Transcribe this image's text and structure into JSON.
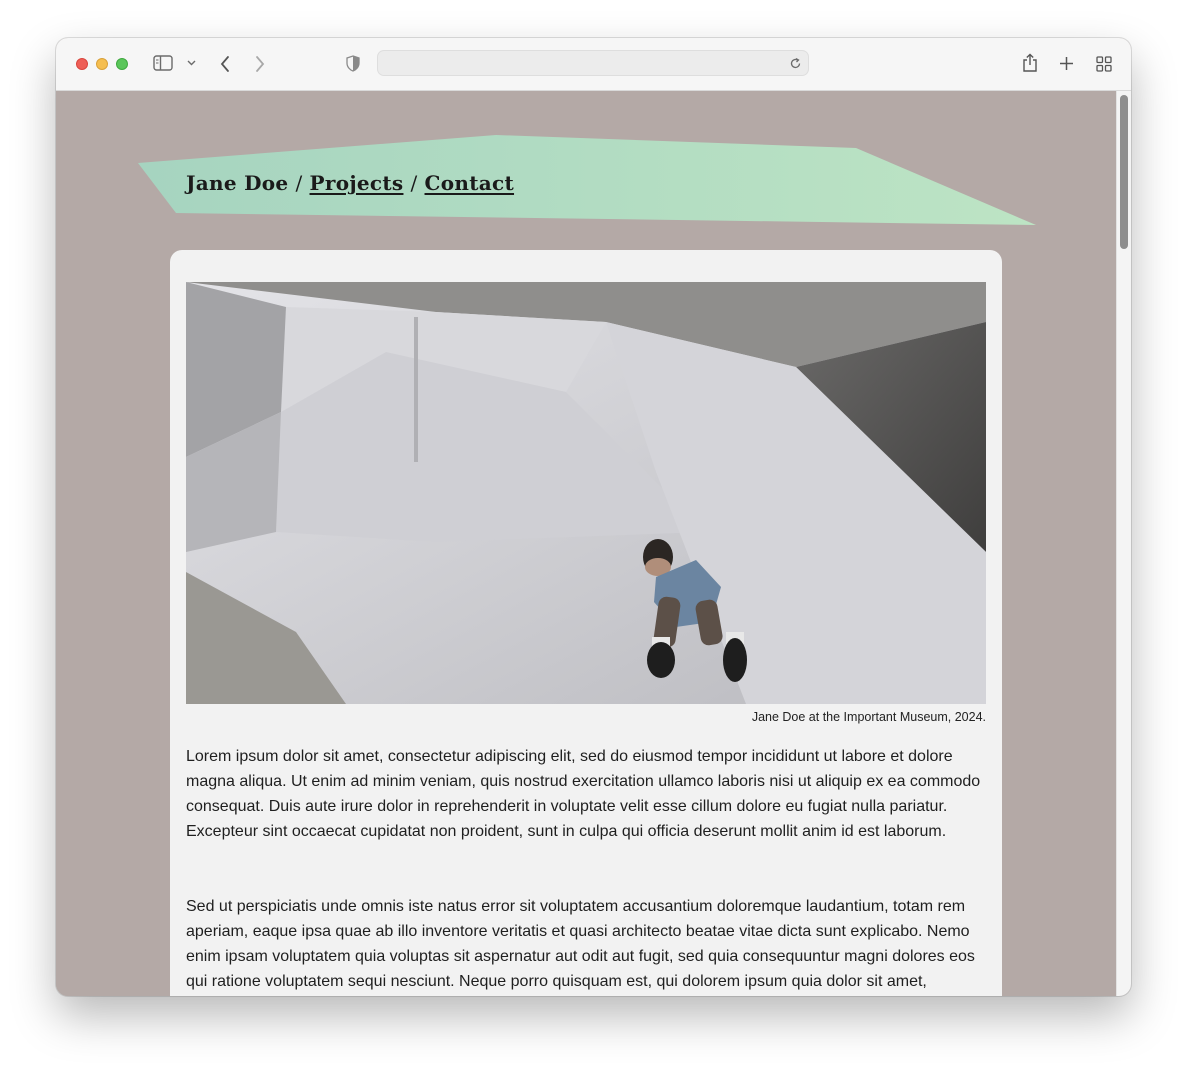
{
  "browser": {
    "url": "",
    "icons": [
      "sidebar-icon",
      "chevron-down-icon",
      "back-icon",
      "forward-icon",
      "privacy-shield-icon",
      "reload-icon",
      "share-icon",
      "new-tab-icon",
      "tab-overview-icon"
    ]
  },
  "nav": {
    "name": "Jane Doe",
    "separator": "/",
    "links": [
      "Projects",
      "Contact"
    ]
  },
  "banner": {
    "color": "#b5dcc0"
  },
  "article": {
    "photo_caption": "Jane Doe at the Important Museum, 2024.",
    "paragraphs": [
      "Lorem ipsum dolor sit amet, consectetur adipiscing elit, sed do eiusmod tempor incididunt ut labore et dolore magna aliqua. Ut enim ad minim veniam, quis nostrud exercitation ullamco laboris nisi ut aliquip ex ea commodo consequat. Duis aute irure dolor in reprehenderit in voluptate velit esse cillum dolore eu fugiat nulla pariatur. Excepteur sint occaecat cupidatat non proident, sunt in culpa qui officia deserunt mollit anim id est laborum.",
      "Sed ut perspiciatis unde omnis iste natus error sit voluptatem accusantium doloremque laudantium, totam rem aperiam, eaque ipsa quae ab illo inventore veritatis et quasi architecto beatae vitae dicta sunt explicabo. Nemo enim ipsam voluptatem quia voluptas sit aspernatur aut odit aut fugit, sed quia consequuntur magni dolores eos qui ratione voluptatem sequi nesciunt. Neque porro quisquam est, qui dolorem ipsum quia dolor sit amet,"
    ]
  },
  "colors": {
    "page_background": "#b4a9a6",
    "card_background": "#f2f2f2"
  }
}
